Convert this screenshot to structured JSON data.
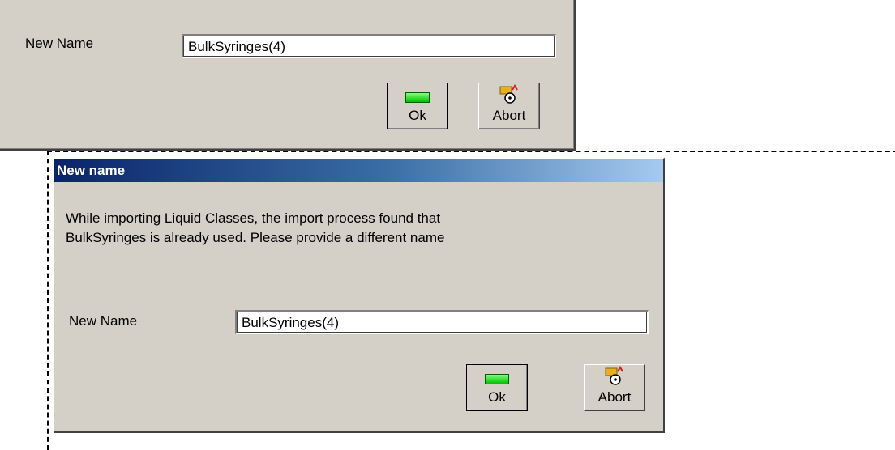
{
  "back_dialog": {
    "field_label": "New Name",
    "field_value": "BulkSyringes(4)",
    "ok_label": "Ok",
    "abort_label": "Abort"
  },
  "dialog": {
    "title": "New name",
    "message_lines": [
      "While importing Liquid Classes, the import process found that",
      "BulkSyringes is already used.  Please provide a different name"
    ],
    "field_label": "New Name",
    "field_value": "BulkSyringes(4)",
    "ok_label": "Ok",
    "abort_label": "Abort"
  },
  "icons": {
    "ok": "green-check-bar-icon",
    "abort": "abort-folder-icon"
  },
  "colors": {
    "dialog_bg": "#d4d0c8",
    "titlebar_start": "#0a246a",
    "titlebar_end": "#a6caf0",
    "ok_icon": "#00c000"
  }
}
